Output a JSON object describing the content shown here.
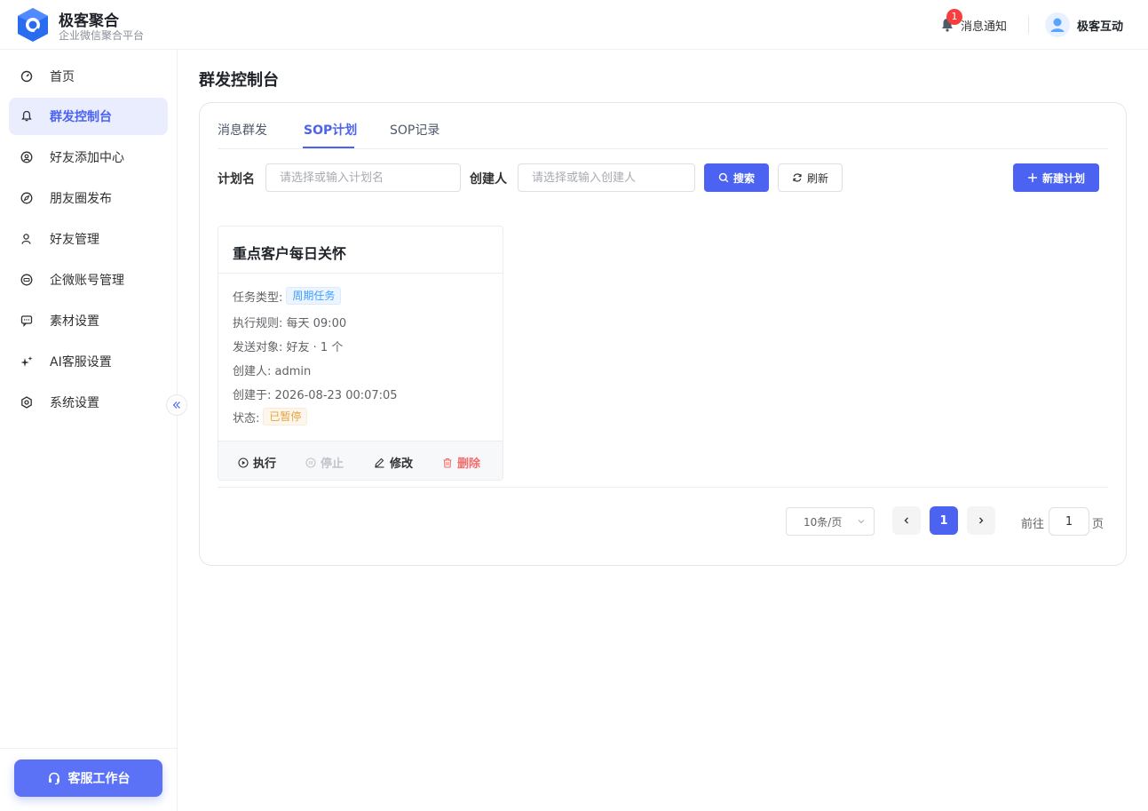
{
  "header": {
    "brand_name": "极客聚合",
    "brand_sub": "企业微信聚合平台",
    "notify_badge": "1",
    "notify_label": "消息通知",
    "user_name": "极客互动",
    "icons": {
      "logo": "brand-logo",
      "bell": "bell-icon",
      "avatar": "user-avatar-icon"
    },
    "colors": {
      "accent": "#4b63f0",
      "badge": "#f53f3f"
    }
  },
  "sidebar": {
    "items": [
      {
        "label": "首页",
        "icon": "dashboard-icon",
        "active": false
      },
      {
        "label": "群发控制台",
        "icon": "bell-icon",
        "active": true
      },
      {
        "label": "好友添加中心",
        "icon": "user-add-icon",
        "active": false
      },
      {
        "label": "朋友圈发布",
        "icon": "compass-icon",
        "active": false
      },
      {
        "label": "好友管理",
        "icon": "user-icon",
        "active": false
      },
      {
        "label": "企微账号管理",
        "icon": "account-icon",
        "active": false
      },
      {
        "label": "素材设置",
        "icon": "chat-icon",
        "active": false
      },
      {
        "label": "AI客服设置",
        "icon": "sparkle-icon",
        "active": false
      },
      {
        "label": "系统设置",
        "icon": "gear-icon",
        "active": false
      }
    ],
    "workbench_label": "客服工作台"
  },
  "main": {
    "page_title": "群发控制台",
    "tabs": [
      {
        "label": "消息群发",
        "active": false
      },
      {
        "label": "SOP计划",
        "active": true
      },
      {
        "label": "SOP记录",
        "active": false
      }
    ],
    "filters": {
      "plan_label": "计划名",
      "plan_placeholder": "请选择或输入计划名",
      "plan_value": "",
      "creator_label": "创建人",
      "creator_placeholder": "请选择或输入创建人",
      "creator_value": "",
      "search_label": "搜索",
      "refresh_label": "刷新",
      "new_label": "新建计划"
    },
    "cards": [
      {
        "title": "重点客户每日关怀",
        "type_label": "任务类型:",
        "type_value": "周期任务",
        "rule": "执行规则: 每天 09:00",
        "target": "发送对象: 好友 · 1 个",
        "creator": "创建人: admin",
        "created": "创建于: 2026-08-23 00:07:05",
        "status_label": "状态:",
        "status_value": "已暂停",
        "actions": {
          "exec": "执行",
          "stop": "停止",
          "edit": "修改",
          "delete": "删除"
        }
      }
    ],
    "pagination": {
      "page_size": "10条/页",
      "current_page": "1",
      "goto_label": "前往",
      "goto_value": "1",
      "page_suffix": "页"
    }
  }
}
